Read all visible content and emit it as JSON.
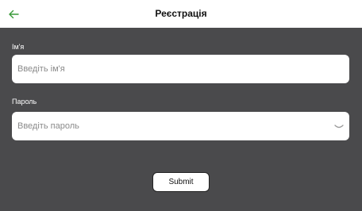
{
  "header": {
    "title": "Реєстрація",
    "back_icon": "arrow-left-icon",
    "accent_color": "#3a9a3a"
  },
  "form": {
    "name_label": "Ім'я",
    "name_placeholder": "Введіть ім'я",
    "password_label": "Пароль",
    "password_placeholder": "Введіть пароль",
    "password_icon": "chevron-down-icon",
    "submit_label": "Submit"
  }
}
